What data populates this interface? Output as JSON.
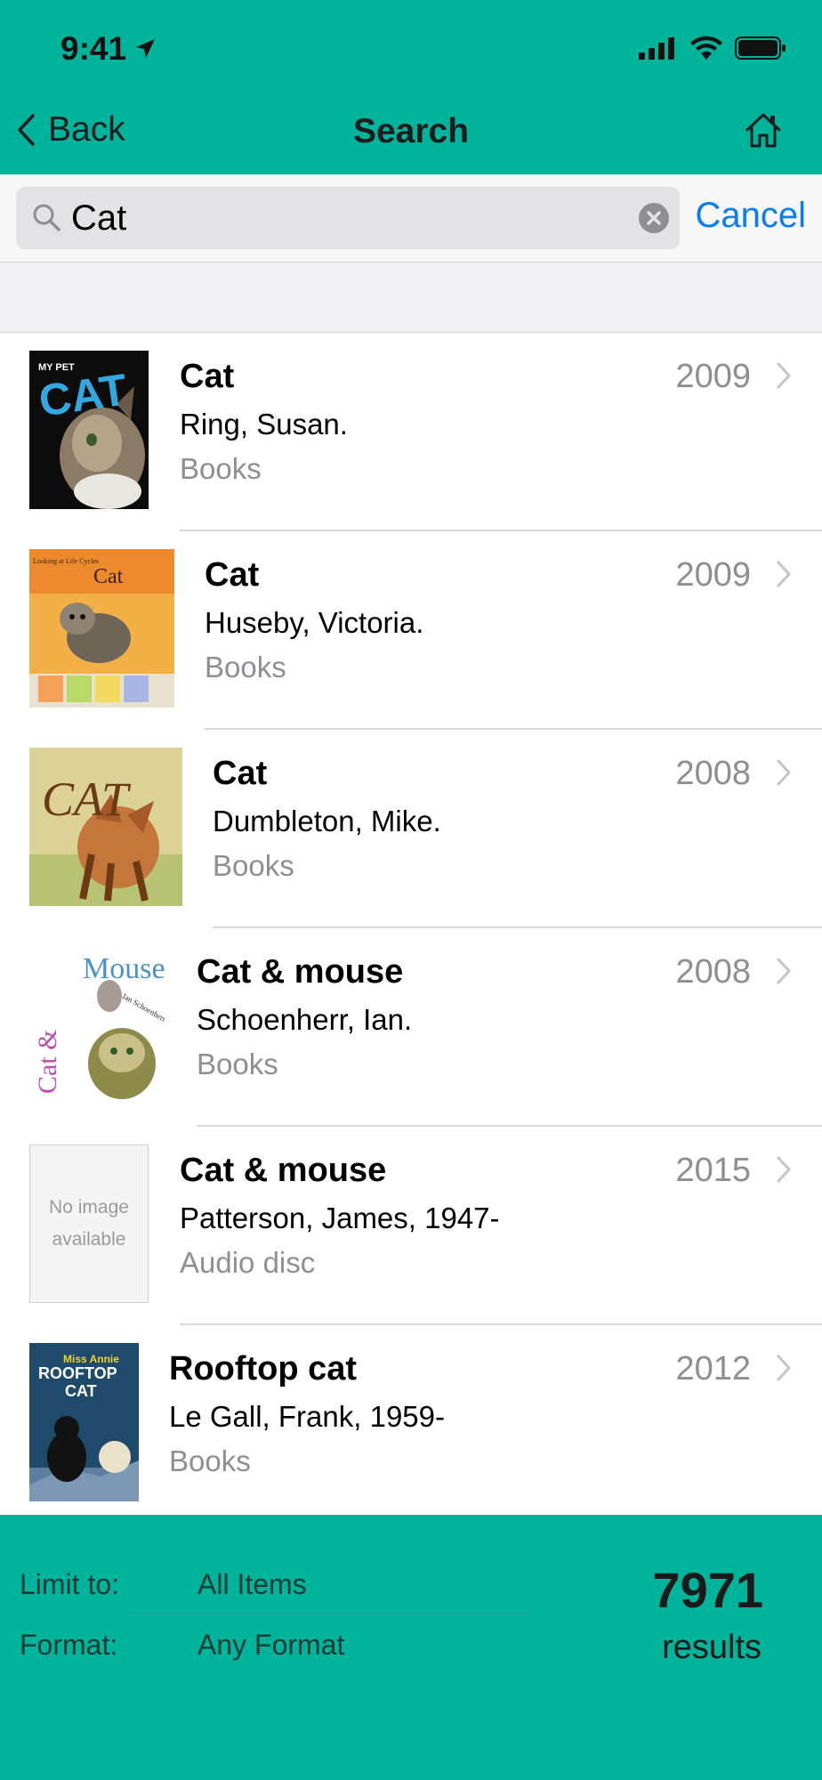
{
  "status": {
    "time": "9:41"
  },
  "nav": {
    "back_label": "Back",
    "title": "Search"
  },
  "search": {
    "query": "Cat",
    "cancel_label": "Cancel"
  },
  "results": [
    {
      "title": "Cat",
      "author": "Ring, Susan.",
      "format": "Books",
      "year": "2009",
      "cover": "my-pet-cat"
    },
    {
      "title": "Cat",
      "author": "Huseby, Victoria.",
      "format": "Books",
      "year": "2009",
      "cover": "looking-at-life-cycles-cat"
    },
    {
      "title": "Cat",
      "author": "Dumbleton, Mike.",
      "format": "Books",
      "year": "2008",
      "cover": "cat-illustrated"
    },
    {
      "title": "Cat & mouse",
      "author": "Schoenherr, Ian.",
      "format": "Books",
      "year": "2008",
      "cover": "cat-and-mouse"
    },
    {
      "title": "Cat & mouse",
      "author": "Patterson, James, 1947-",
      "format": "Audio disc",
      "year": "2015",
      "cover": "no-image",
      "placeholder_text": "No image available"
    },
    {
      "title": "Rooftop cat",
      "author": "Le Gall, Frank, 1959-",
      "format": "Books",
      "year": "2012",
      "cover": "rooftop-cat"
    }
  ],
  "covers": {
    "cover1": {
      "small": "MY PET",
      "big": "CAT"
    },
    "cover2": {
      "small": "Looking at Life Cycles",
      "big": "Cat"
    },
    "cover3": {
      "big": "CAT"
    },
    "cover4": {
      "big1": "Mouse",
      "big2": "Cat &",
      "small": "Ian Schoenherr"
    },
    "cover6": {
      "small": "Miss Annie",
      "big1": "ROOFTOP",
      "big2": "CAT"
    }
  },
  "filters": {
    "limit_label": "Limit to:",
    "limit_value": "All Items",
    "format_label": "Format:",
    "format_value": "Any Format"
  },
  "summary": {
    "count": "7971",
    "label": "results"
  },
  "colors": {
    "teal": "#00b49c",
    "link": "#0a7cf2",
    "secondary": "#8e8e93"
  }
}
